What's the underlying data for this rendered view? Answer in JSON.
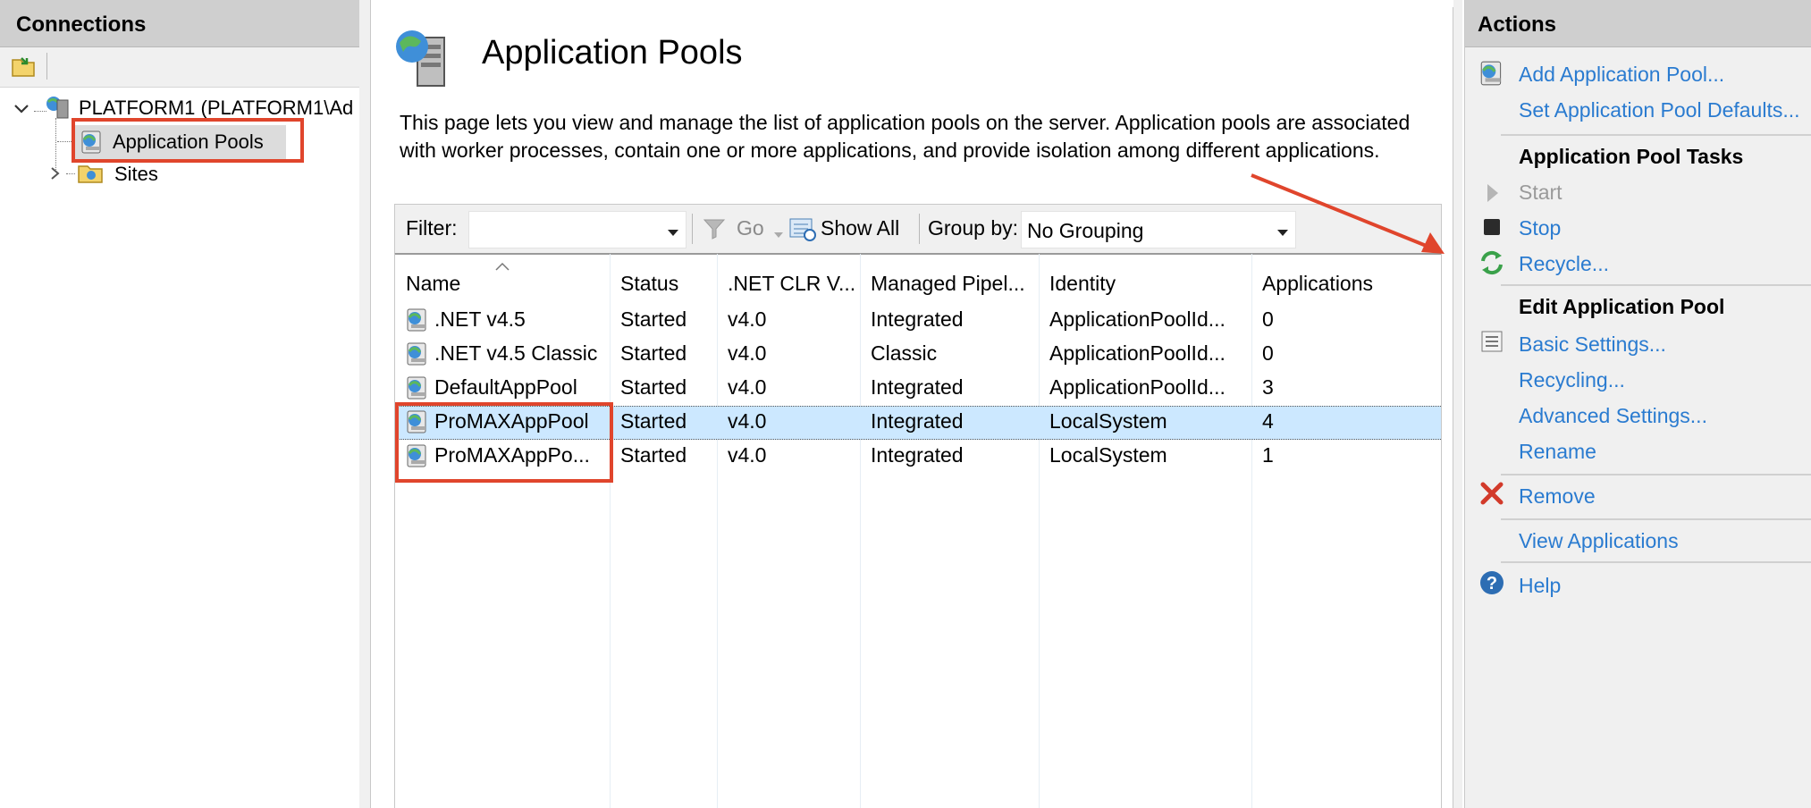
{
  "connections": {
    "header": "Connections",
    "tree": {
      "server_label": "PLATFORM1 (PLATFORM1\\Ad",
      "app_pools_label": "Application Pools",
      "sites_label": "Sites"
    }
  },
  "main": {
    "title": "Application Pools",
    "description": "This page lets you view and manage the list of application pools on the server. Application pools are associated with worker processes, contain one or more applications, and provide isolation among different applications.",
    "filter_bar": {
      "filter_label": "Filter:",
      "filter_value": "",
      "go_label": "Go",
      "show_all_label": "Show All",
      "group_by_label": "Group by:",
      "group_by_value": "No Grouping"
    },
    "table": {
      "columns": [
        "Name",
        "Status",
        ".NET CLR V...",
        "Managed Pipel...",
        "Identity",
        "Applications"
      ],
      "rows": [
        {
          "name": ".NET v4.5",
          "status": "Started",
          "clr": "v4.0",
          "pipeline": "Integrated",
          "identity": "ApplicationPoolId...",
          "apps": "0"
        },
        {
          "name": ".NET v4.5 Classic",
          "status": "Started",
          "clr": "v4.0",
          "pipeline": "Classic",
          "identity": "ApplicationPoolId...",
          "apps": "0"
        },
        {
          "name": "DefaultAppPool",
          "status": "Started",
          "clr": "v4.0",
          "pipeline": "Integrated",
          "identity": "ApplicationPoolId...",
          "apps": "3"
        },
        {
          "name": "ProMAXAppPool",
          "status": "Started",
          "clr": "v4.0",
          "pipeline": "Integrated",
          "identity": "LocalSystem",
          "apps": "4"
        },
        {
          "name": "ProMAXAppPo...",
          "status": "Started",
          "clr": "v4.0",
          "pipeline": "Integrated",
          "identity": "LocalSystem",
          "apps": "1"
        }
      ]
    }
  },
  "actions": {
    "header": "Actions",
    "add_pool": "Add Application Pool...",
    "set_defaults": "Set Application Pool Defaults...",
    "tasks_heading": "Application Pool Tasks",
    "start": "Start",
    "stop": "Stop",
    "recycle": "Recycle...",
    "edit_heading": "Edit Application Pool",
    "basic_settings": "Basic Settings...",
    "recycling": "Recycling...",
    "advanced_settings": "Advanced Settings...",
    "rename": "Rename",
    "remove": "Remove",
    "view_applications": "View Applications",
    "help": "Help"
  },
  "colors": {
    "link": "#2a7bd0",
    "selection": "#cce8ff",
    "annotation": "#e0452c"
  }
}
